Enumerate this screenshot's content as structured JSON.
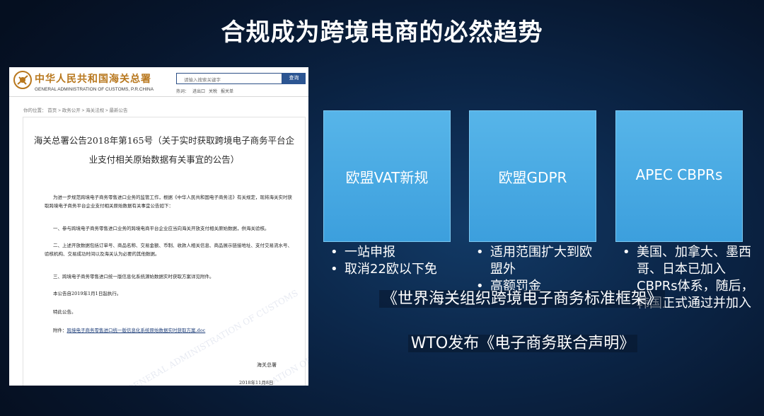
{
  "slide": {
    "title": "合规成为跨境电商的必然趋势"
  },
  "screenshot": {
    "site_name": "中华人民共和国海关总署",
    "site_name_en": "GENERAL ADMINISTRATION OF CUSTOMS, P.R.CHINA",
    "search": {
      "placeholder": "请输入搜索关键字",
      "button": "查询"
    },
    "quick_links": [
      "热词：",
      "进出口",
      "关税",
      "报关单"
    ],
    "breadcrumb": "你的位置： 首页 > 政务公开 > 海关法规 > 最新公告",
    "doc": {
      "title_line1": "海关总署公告2018年第165号（关于实时获取跨境电子商务平台企",
      "title_line2": "业支付相关原始数据有关事宜的公告）",
      "para_intro": "为进一步规范跨境电子商务零售进口业务的监管工作，根据《中华人民共和国电子商务法》有关规定，现将海关实时获取跨境电子商务平台企业支付相关原始数据有关事宜公告如下：",
      "para_1": "一、参与跨境电子商务零售进口业务的跨境电商平台企业应当向海关开放支付相关原始数据，供海关验核。",
      "para_2": "二、上述开放数据包括订单号、商品名称、交易金额、币制、收款人相关信息、商品展示链接地址、支付交易流水号、验核机构、交易成功时间以及海关认为必要的其他数据。",
      "para_3": "三、跨境电子商务零售进口统一版信息化系统源始数据实时获取方案详见附件。",
      "para_4": "本公告自2019年1月1日起执行。",
      "para_5": "特此公告。",
      "attachment_label": "附件：",
      "attachment_link": "跨境电子商务零售进口统一版信息化系统原始数据实时获取方案.doc",
      "signature": "海关总署",
      "date": "2018年11月8日"
    }
  },
  "cards": [
    {
      "label": "欧盟VAT新规"
    },
    {
      "label": "欧盟GDPR"
    },
    {
      "label": "APEC CBPRs"
    }
  ],
  "bullets": {
    "col1": [
      "一站申报",
      "取消22欧以下免"
    ],
    "col2": [
      "适用范围扩大到欧盟外",
      "高额罚金"
    ],
    "col3": [
      "美国、加拿大、墨西哥、日本已加入CBPRs体系，随后，韩国正式通过并加入"
    ]
  },
  "overlay": {
    "line1": "《世界海关组织跨境电子商务标准框架》",
    "line2": "WTO发布《电子商务联合声明》"
  },
  "colors": {
    "card_blue": "#4aaae4",
    "background": "#0b2547",
    "site_gold": "#b8771d",
    "search_blue": "#2c5592"
  }
}
